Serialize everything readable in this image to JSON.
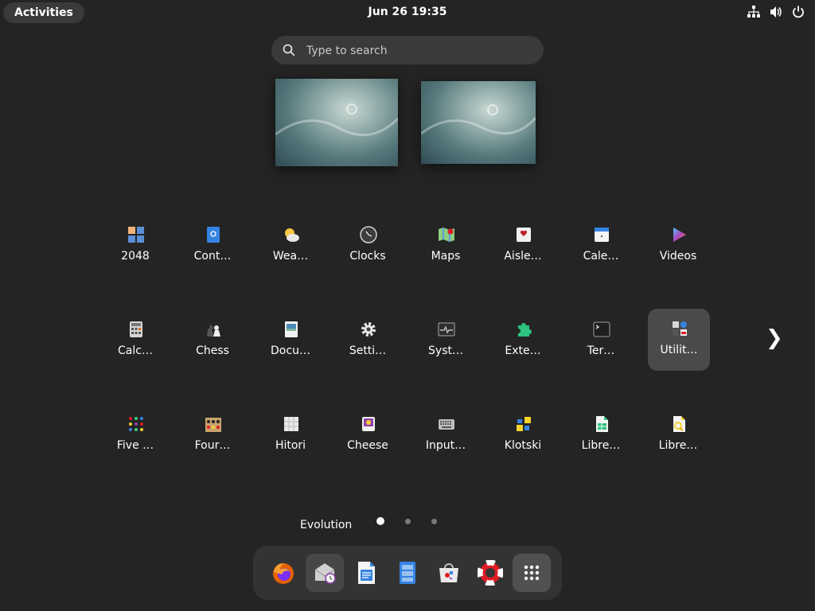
{
  "topbar": {
    "activities_label": "Activities",
    "clock": "Jun 26  19:35",
    "tray_icons": [
      "network-icon",
      "volume-icon",
      "power-icon"
    ]
  },
  "search": {
    "placeholder": "Type to search"
  },
  "apps": {
    "row1": [
      "2048",
      "Cont…",
      "Wea…",
      "Clocks",
      "Maps",
      "Aisle…",
      "Cale…",
      "Videos"
    ],
    "row2": [
      "Calc…",
      "Chess",
      "Docu…",
      "Setti…",
      "Syst…",
      "Exte…",
      "Ter…",
      "Utilit…"
    ],
    "row3": [
      "Five …",
      "Four…",
      "Hitori",
      "Cheese",
      "Input…",
      "Klotski",
      "Libre…",
      "Libre…"
    ]
  },
  "hover_label": "Evolution",
  "pagination": {
    "pages": 3,
    "current": 1
  },
  "dock": {
    "items": [
      "firefox-icon",
      "evolution-icon",
      "libreoffice-writer-icon",
      "files-icon",
      "software-icon",
      "help-icon",
      "show-apps-icon"
    ]
  },
  "colors": {
    "background": "#242424",
    "accent_selected": "#4a4a4a",
    "dock": "#333333"
  }
}
